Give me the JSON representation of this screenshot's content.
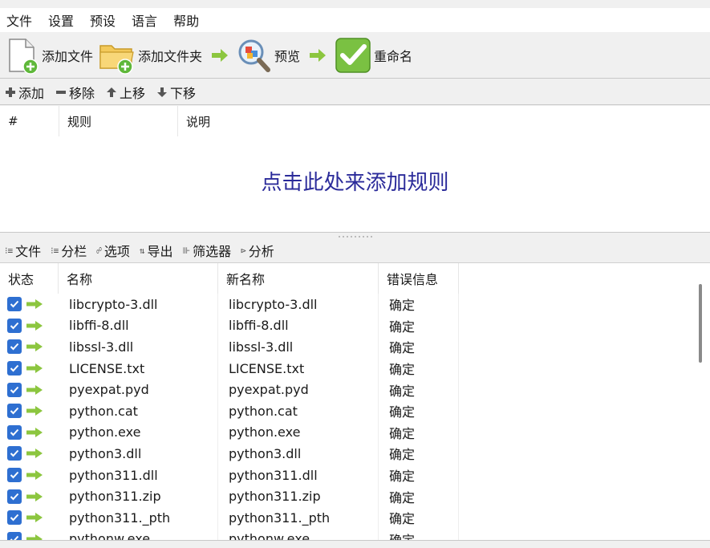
{
  "menu": [
    "文件",
    "设置",
    "预设",
    "语言",
    "帮助"
  ],
  "toolbar": {
    "add_files": "添加文件",
    "add_folder": "添加文件夹",
    "preview": "预览",
    "rename": "重命名"
  },
  "rules_toolbar": {
    "add": "添加",
    "remove": "移除",
    "move_up": "上移",
    "move_down": "下移"
  },
  "rules": {
    "columns": [
      "#",
      "规则",
      "说明"
    ],
    "empty_hint": "点击此处来添加规则"
  },
  "file_tabs": [
    "文件",
    "分栏",
    "选项",
    "导出",
    "筛选器",
    "分析"
  ],
  "file_list": {
    "columns": [
      "状态",
      "名称",
      "新名称",
      "错误信息"
    ],
    "rows": [
      {
        "name": "libcrypto-3.dll",
        "new_name": "libcrypto-3.dll",
        "error": "确定"
      },
      {
        "name": "libffi-8.dll",
        "new_name": "libffi-8.dll",
        "error": "确定"
      },
      {
        "name": "libssl-3.dll",
        "new_name": "libssl-3.dll",
        "error": "确定"
      },
      {
        "name": "LICENSE.txt",
        "new_name": "LICENSE.txt",
        "error": "确定"
      },
      {
        "name": "pyexpat.pyd",
        "new_name": "pyexpat.pyd",
        "error": "确定"
      },
      {
        "name": "python.cat",
        "new_name": "python.cat",
        "error": "确定"
      },
      {
        "name": "python.exe",
        "new_name": "python.exe",
        "error": "确定"
      },
      {
        "name": "python3.dll",
        "new_name": "python3.dll",
        "error": "确定"
      },
      {
        "name": "python311.dll",
        "new_name": "python311.dll",
        "error": "确定"
      },
      {
        "name": "python311.zip",
        "new_name": "python311.zip",
        "error": "确定"
      },
      {
        "name": "python311._pth",
        "new_name": "python311._pth",
        "error": "确定"
      },
      {
        "name": "pythonw.exe",
        "new_name": "pythonw.exe",
        "error": "确定"
      }
    ]
  },
  "colors": {
    "accent_blue": "#2e6fd1",
    "hint_text": "#2b2b9a",
    "arrow_green": "#8cc63f",
    "rename_green": "#7ac142"
  }
}
